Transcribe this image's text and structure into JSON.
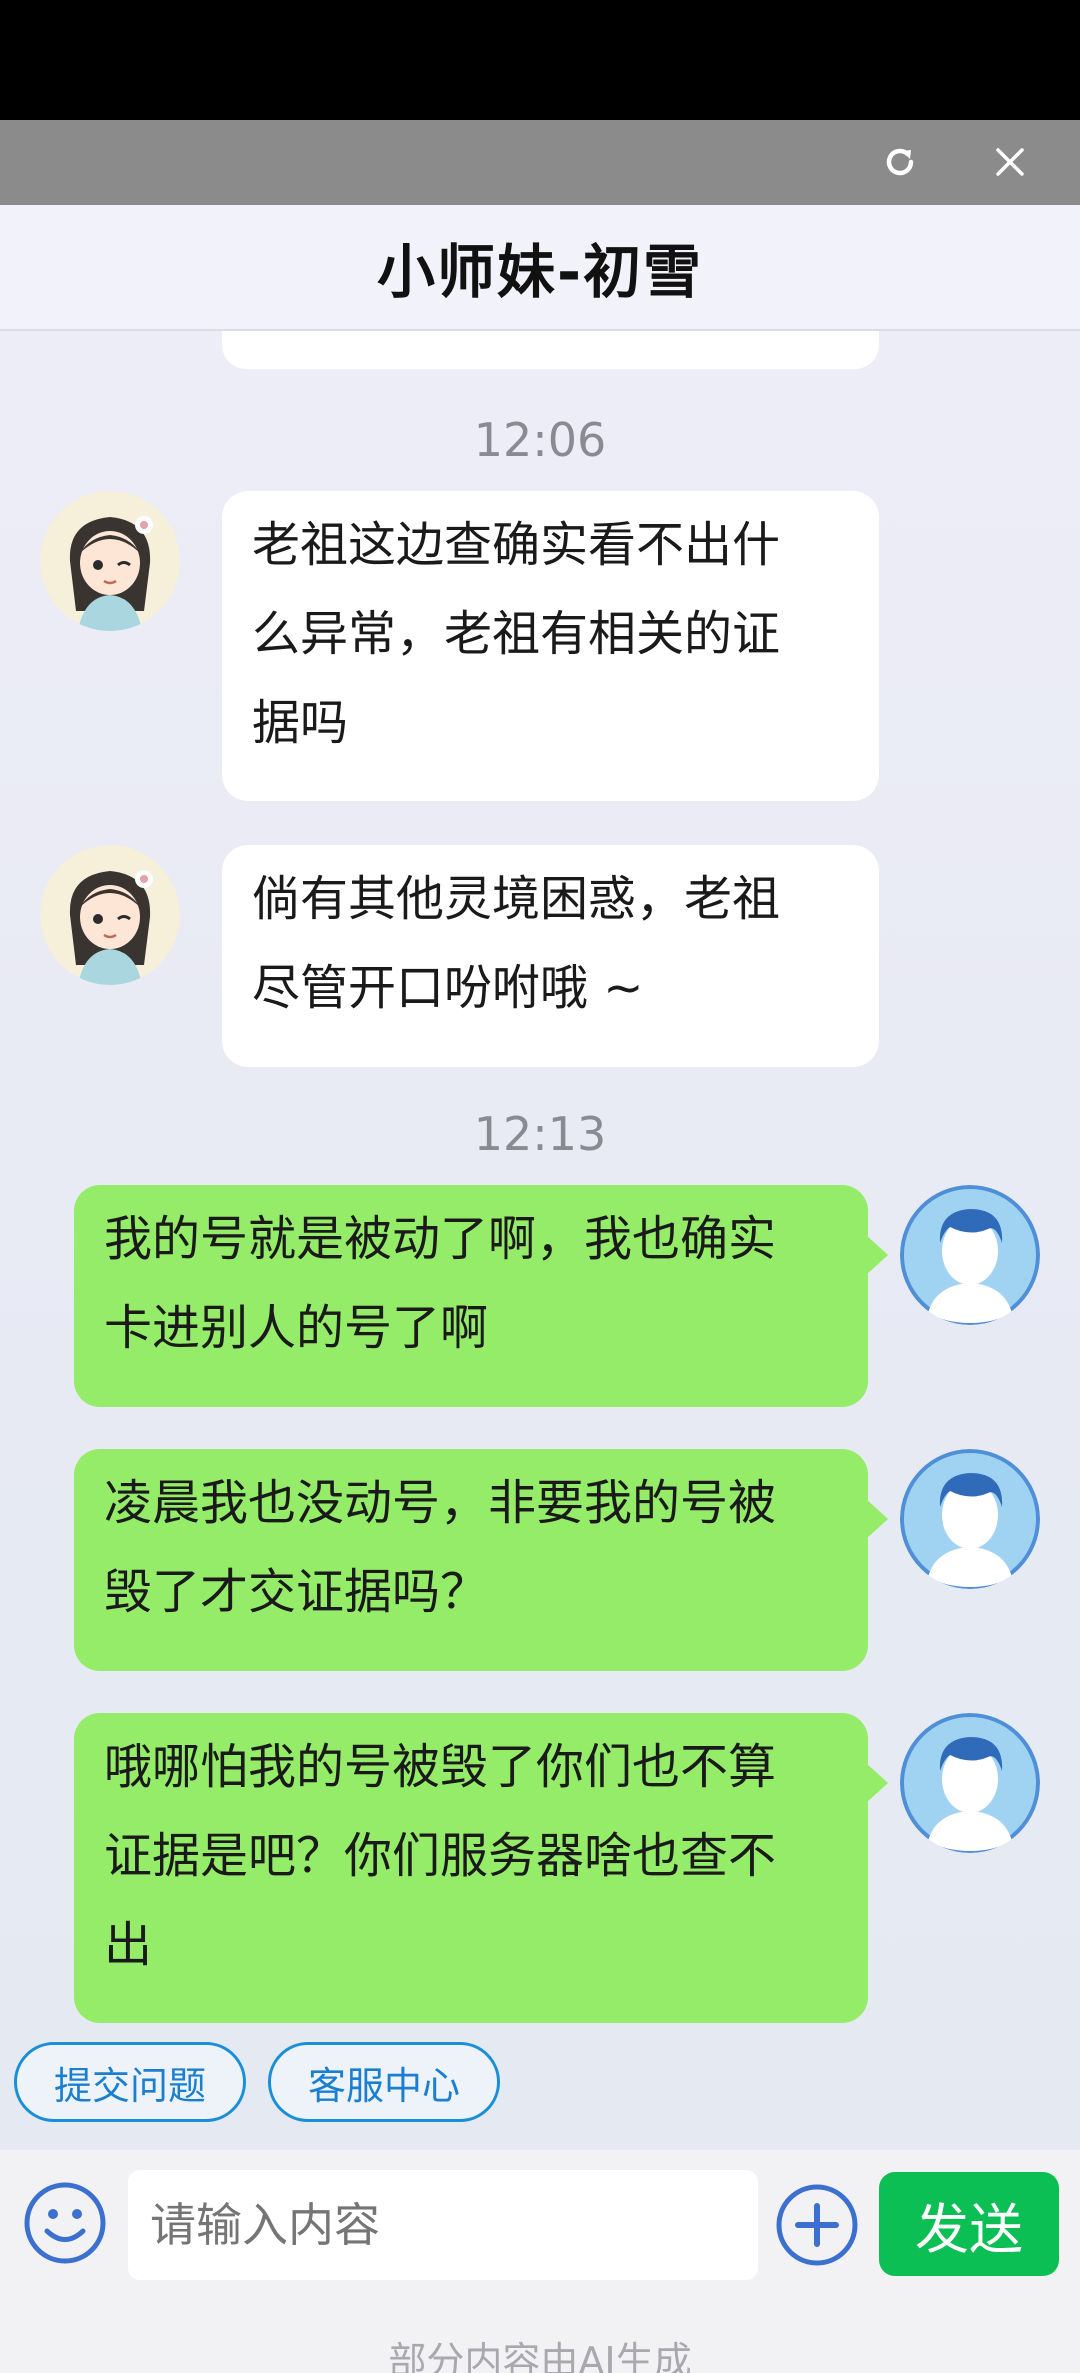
{
  "header": {
    "title": "小师妹-初雪"
  },
  "messages": [
    {
      "type": "time",
      "text": "12:06"
    },
    {
      "type": "incoming",
      "lines": [
        "老祖这边查确实看不出什",
        "么异常，老祖有相关的证",
        "据吗"
      ]
    },
    {
      "type": "incoming",
      "lines": [
        "倘有其他灵境困惑，老祖",
        "尽管开口吩咐哦 ~"
      ]
    },
    {
      "type": "time",
      "text": "12:13"
    },
    {
      "type": "outgoing",
      "lines": [
        "我的号就是被动了啊，我也确实",
        "卡进别人的号了啊"
      ]
    },
    {
      "type": "outgoing",
      "lines": [
        "凌晨我也没动号，非要我的号被",
        "毁了才交证据吗？"
      ]
    },
    {
      "type": "outgoing",
      "lines": [
        "哦哪怕我的号被毁了你们也不算",
        "证据是吧？你们服务器啥也查不",
        "出"
      ]
    }
  ],
  "quick_actions": [
    "提交问题",
    "客服中心"
  ],
  "input": {
    "placeholder": "请输入内容"
  },
  "send_label": "发送",
  "footnote": "部分内容由AI生成",
  "colors": {
    "outgoing_bubble": "#95ec69",
    "send_button": "#0bbf54",
    "quick_border": "#1a8fd8"
  }
}
